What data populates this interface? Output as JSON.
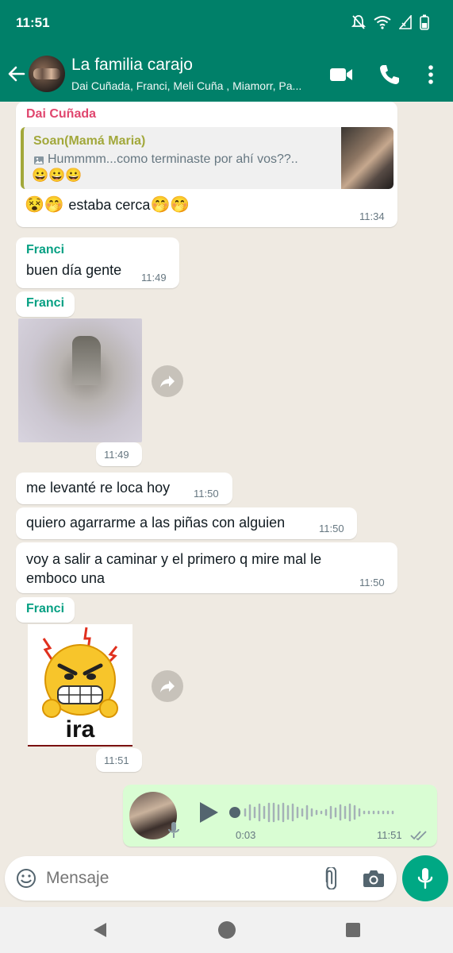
{
  "status_bar": {
    "time": "11:51"
  },
  "header": {
    "title": "La familia carajo",
    "subtitle": "Dai Cuñada, Franci, Meli Cuña , Miamorr, Pa..."
  },
  "colors": {
    "header": "#008069",
    "accent": "#00a884",
    "sender_dai": "#e0466e",
    "sender_franci": "#06a083",
    "quote_name": "#a2a83b",
    "outgoing_bubble": "#d9fdd3"
  },
  "messages": {
    "m1": {
      "sender": "Dai Cuñada",
      "quote_author": "Soan(Mamá Maria)",
      "quote_text": "Hummmm...como terminaste por ahí vos??..",
      "quote_emojis": "😀😀😀",
      "emoji_prefix": "😵🤭",
      "text": "estaba cerca",
      "emoji_suffix": "🤭🤭",
      "time": "11:34"
    },
    "m2": {
      "sender": "Franci",
      "text": "buen día gente",
      "time": "11:49"
    },
    "m3": {
      "sender": "Franci",
      "time": "11:49"
    },
    "m4": {
      "text": "me levanté re loca hoy",
      "time": "11:50"
    },
    "m5": {
      "text": "quiero agarrarme a las piñas con alguien",
      "time": "11:50"
    },
    "m6": {
      "text": "voy a salir a caminar y el primero q mire mal le emboco una",
      "time": "11:50"
    },
    "m7": {
      "sender": "Franci",
      "sticker_text": "ira",
      "time": "11:51"
    },
    "m8": {
      "duration": "0:03",
      "time": "11:51"
    }
  },
  "composer": {
    "placeholder": "Mensaje"
  },
  "icons": [
    "back-arrow-icon",
    "video-call-icon",
    "phone-icon",
    "more-options-icon",
    "image-icon",
    "forward-icon",
    "play-icon",
    "mic-icon",
    "emoji-icon",
    "attach-icon",
    "camera-icon",
    "double-check-icon",
    "nav-back-icon",
    "nav-home-icon",
    "nav-recents-icon"
  ]
}
